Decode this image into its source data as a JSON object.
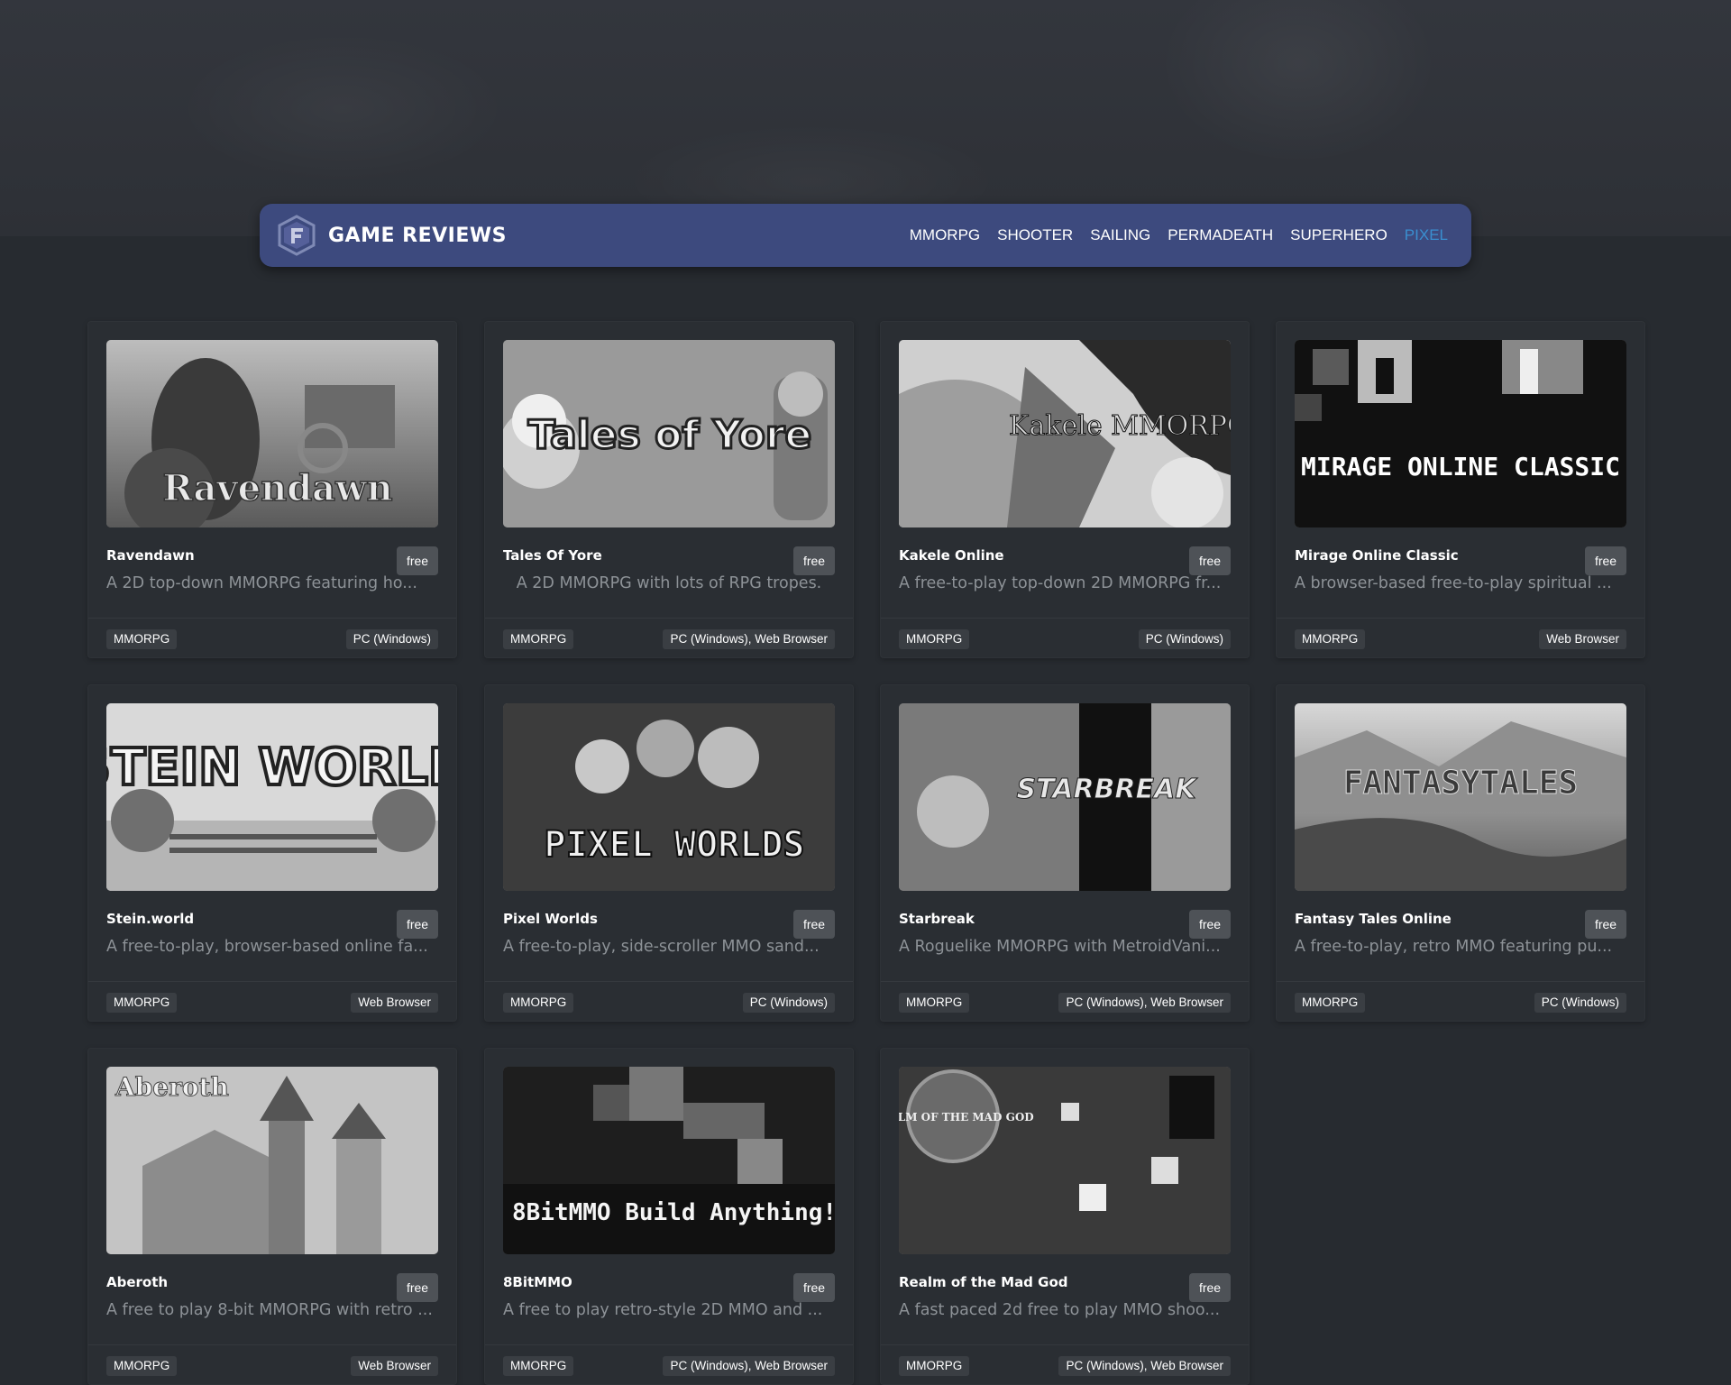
{
  "header": {
    "brand": "GAME REVIEWS",
    "nav": [
      {
        "label": "MMORPG",
        "active": false
      },
      {
        "label": "SHOOTER",
        "active": false
      },
      {
        "label": "SAILING",
        "active": false
      },
      {
        "label": "PERMADEATH",
        "active": false
      },
      {
        "label": "SUPERHERO",
        "active": false
      },
      {
        "label": "PIXEL",
        "active": true
      }
    ]
  },
  "games": [
    {
      "title": "Ravendawn",
      "price": "free",
      "description": "A 2D top-down MMORPG featuring ho...",
      "genre": "MMORPG",
      "platform": "PC (Windows)",
      "art_text": "Ravendawn"
    },
    {
      "title": "Tales Of Yore",
      "price": "free",
      "description": "A 2D MMORPG with lots of RPG tropes.",
      "genre": "MMORPG",
      "platform": "PC (Windows), Web Browser",
      "art_text": "Tales of Yore"
    },
    {
      "title": "Kakele Online",
      "price": "free",
      "description": "A free-to-play top-down 2D MMORPG fr...",
      "genre": "MMORPG",
      "platform": "PC (Windows)",
      "art_text": "Kakele MMORPG"
    },
    {
      "title": "Mirage Online Classic",
      "price": "free",
      "description": "A browser-based free-to-play spiritual ...",
      "genre": "MMORPG",
      "platform": "Web Browser",
      "art_text": "MIRAGE ONLINE CLASSIC"
    },
    {
      "title": "Stein.world",
      "price": "free",
      "description": "A free-to-play, browser-based online fa...",
      "genre": "MMORPG",
      "platform": "Web Browser",
      "art_text": "STEIN WORLD"
    },
    {
      "title": "Pixel Worlds",
      "price": "free",
      "description": "A free-to-play, side-scroller MMO sand...",
      "genre": "MMORPG",
      "platform": "PC (Windows)",
      "art_text": "PIXEL WORLDS"
    },
    {
      "title": "Starbreak",
      "price": "free",
      "description": "A Roguelike MMORPG with MetroidVani...",
      "genre": "MMORPG",
      "platform": "PC (Windows), Web Browser",
      "art_text": "STARBREAK"
    },
    {
      "title": "Fantasy Tales Online",
      "price": "free",
      "description": "A free-to-play, retro MMO featuring pu...",
      "genre": "MMORPG",
      "platform": "PC (Windows)",
      "art_text": "FANTASYTALES"
    },
    {
      "title": "Aberoth",
      "price": "free",
      "description": "A free to play 8-bit MMORPG with retro ...",
      "genre": "MMORPG",
      "platform": "Web Browser",
      "art_text": "Aberoth"
    },
    {
      "title": "8BitMMO",
      "price": "free",
      "description": "A free to play retro-style 2D MMO and ...",
      "genre": "MMORPG",
      "platform": "PC (Windows), Web Browser",
      "art_text": "8BitMMO Build Anything!"
    },
    {
      "title": "Realm of the Mad God",
      "price": "free",
      "description": "A fast paced 2d free to play MMO shoo...",
      "genre": "MMORPG",
      "platform": "PC (Windows), Web Browser",
      "art_text": "REALM OF THE MAD GOD"
    }
  ]
}
